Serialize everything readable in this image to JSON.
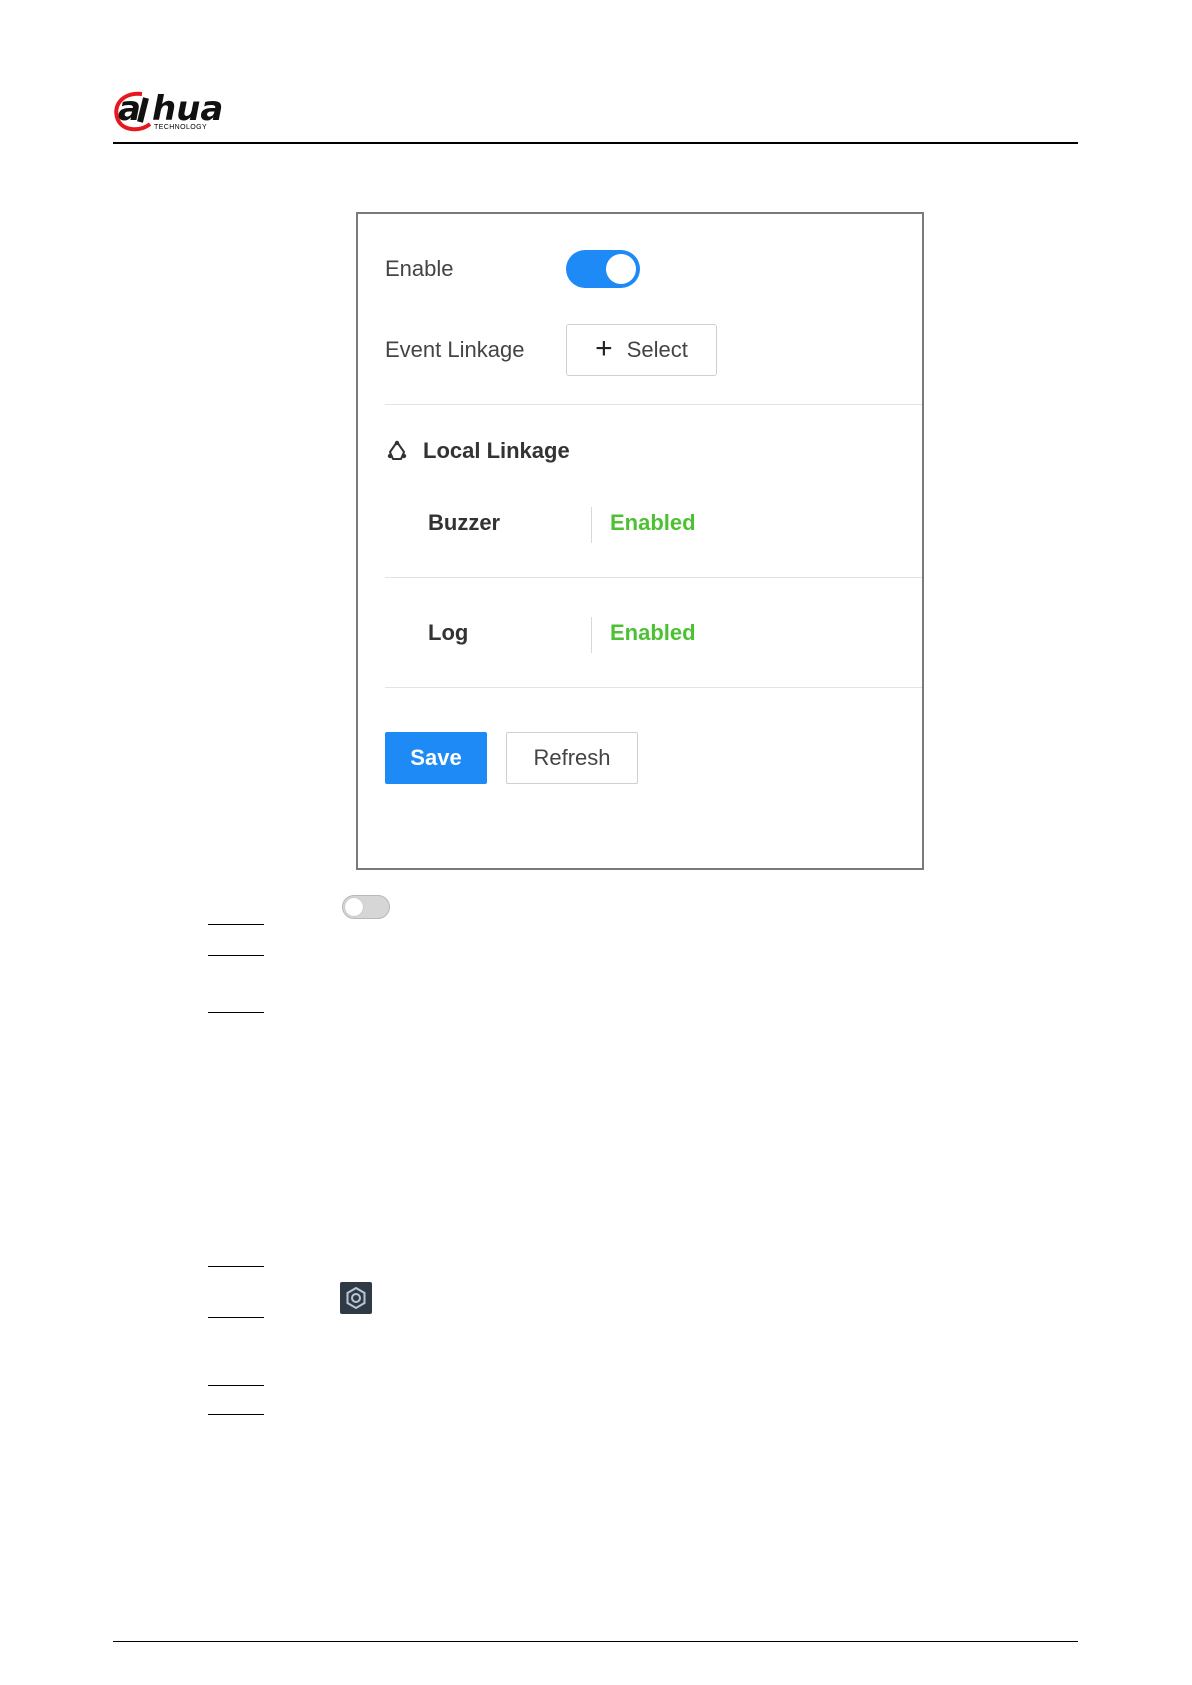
{
  "logo": {
    "brand": "alhua",
    "tagline": "TECHNOLOGY",
    "accent_color": "#e8161d"
  },
  "panel": {
    "enable_label": "Enable",
    "enable_on": true,
    "event_linkage_label": "Event Linkage",
    "select_button": "Select",
    "section_title": "Local Linkage",
    "items": [
      {
        "label": "Buzzer",
        "value": "Enabled"
      },
      {
        "label": "Log",
        "value": "Enabled"
      }
    ],
    "save_button": "Save",
    "refresh_button": "Refresh",
    "primary_color": "#1e8af5",
    "enabled_color": "#4cc232"
  },
  "inline_icons": {
    "toggle_off": {
      "on": false
    },
    "settings_icon": "gear-icon"
  }
}
